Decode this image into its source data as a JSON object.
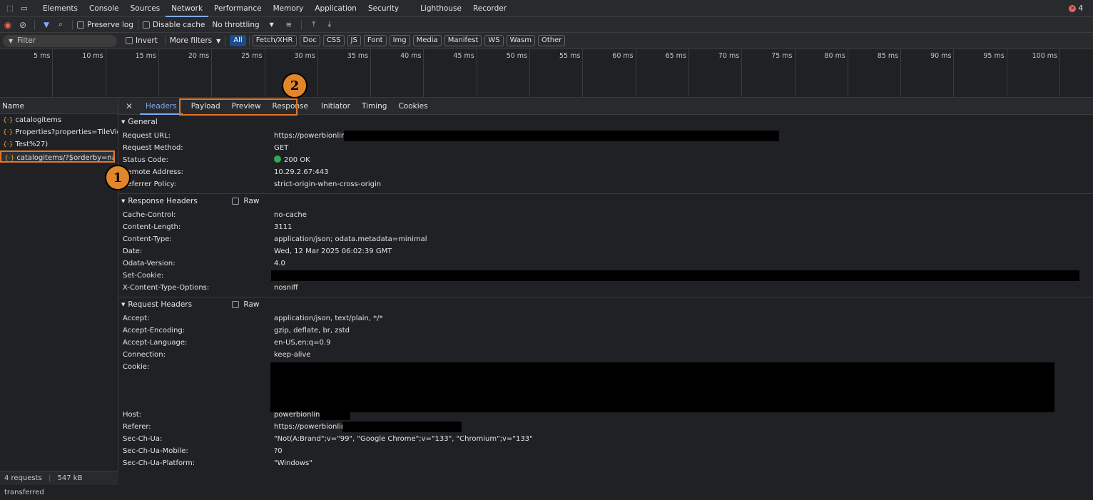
{
  "top_tabs": [
    "Elements",
    "Console",
    "Sources",
    "Network",
    "Performance",
    "Memory",
    "Application",
    "Security",
    "Lighthouse",
    "Recorder"
  ],
  "active_top_tab": "Network",
  "error_count": "4",
  "toolbar": {
    "preserve_log": "Preserve log",
    "disable_cache": "Disable cache",
    "throttling": "No throttling"
  },
  "filterbar": {
    "filter_placeholder": "Filter",
    "invert": "Invert",
    "more_filters": "More filters",
    "types": [
      "All",
      "Fetch/XHR",
      "Doc",
      "CSS",
      "JS",
      "Font",
      "Img",
      "Media",
      "Manifest",
      "WS",
      "Wasm",
      "Other"
    ]
  },
  "timeline_ticks": [
    "5 ms",
    "10 ms",
    "15 ms",
    "20 ms",
    "25 ms",
    "30 ms",
    "35 ms",
    "40 ms",
    "45 ms",
    "50 ms",
    "55 ms",
    "60 ms",
    "65 ms",
    "70 ms",
    "75 ms",
    "80 ms",
    "85 ms",
    "90 ms",
    "95 ms",
    "100 ms"
  ],
  "name_header": "Name",
  "requests": [
    "catalogitems",
    "Properties?properties=TileVie...",
    "Test%27)",
    "catalogitems/?$orderby=nam..."
  ],
  "status": {
    "requests": "4 requests",
    "transferred": "547 kB transferred"
  },
  "detail_tabs": [
    "Headers",
    "Payload",
    "Preview",
    "Response",
    "Initiator",
    "Timing",
    "Cookies"
  ],
  "general": {
    "title": "General",
    "rows": [
      {
        "k": "Request URL:",
        "v": "https://powerbionline"
      },
      {
        "k": "Request Method:",
        "v": "GET"
      },
      {
        "k": "Status Code:",
        "v": "200 OK"
      },
      {
        "k": "Remote Address:",
        "v": "10.29.2.67:443"
      },
      {
        "k": "Referrer Policy:",
        "v": "strict-origin-when-cross-origin"
      }
    ]
  },
  "response_headers": {
    "title": "Response Headers",
    "raw": "Raw",
    "rows": [
      {
        "k": "Cache-Control:",
        "v": "no-cache"
      },
      {
        "k": "Content-Length:",
        "v": "3111"
      },
      {
        "k": "Content-Type:",
        "v": "application/json; odata.metadata=minimal"
      },
      {
        "k": "Date:",
        "v": "Wed, 12 Mar 2025 06:02:39 GMT"
      },
      {
        "k": "Odata-Version:",
        "v": "4.0"
      },
      {
        "k": "Set-Cookie:",
        "v": ""
      },
      {
        "k": "X-Content-Type-Options:",
        "v": "nosniff"
      }
    ]
  },
  "request_headers": {
    "title": "Request Headers",
    "raw": "Raw",
    "rows": [
      {
        "k": "Accept:",
        "v": "application/json, text/plain, */*"
      },
      {
        "k": "Accept-Encoding:",
        "v": "gzip, deflate, br, zstd"
      },
      {
        "k": "Accept-Language:",
        "v": "en-US,en;q=0.9"
      },
      {
        "k": "Connection:",
        "v": "keep-alive"
      },
      {
        "k": "Cookie:",
        "v": ""
      },
      {
        "k": "Host:",
        "v": "powerbionline"
      },
      {
        "k": "Referer:",
        "v": "https://powerbionline"
      },
      {
        "k": "Sec-Ch-Ua:",
        "v": "\"Not(A:Brand\";v=\"99\", \"Google Chrome\";v=\"133\", \"Chromium\";v=\"133\""
      },
      {
        "k": "Sec-Ch-Ua-Mobile:",
        "v": "?0"
      },
      {
        "k": "Sec-Ch-Ua-Platform:",
        "v": "\"Windows\""
      }
    ]
  },
  "badges": {
    "one": "1",
    "two": "2"
  }
}
